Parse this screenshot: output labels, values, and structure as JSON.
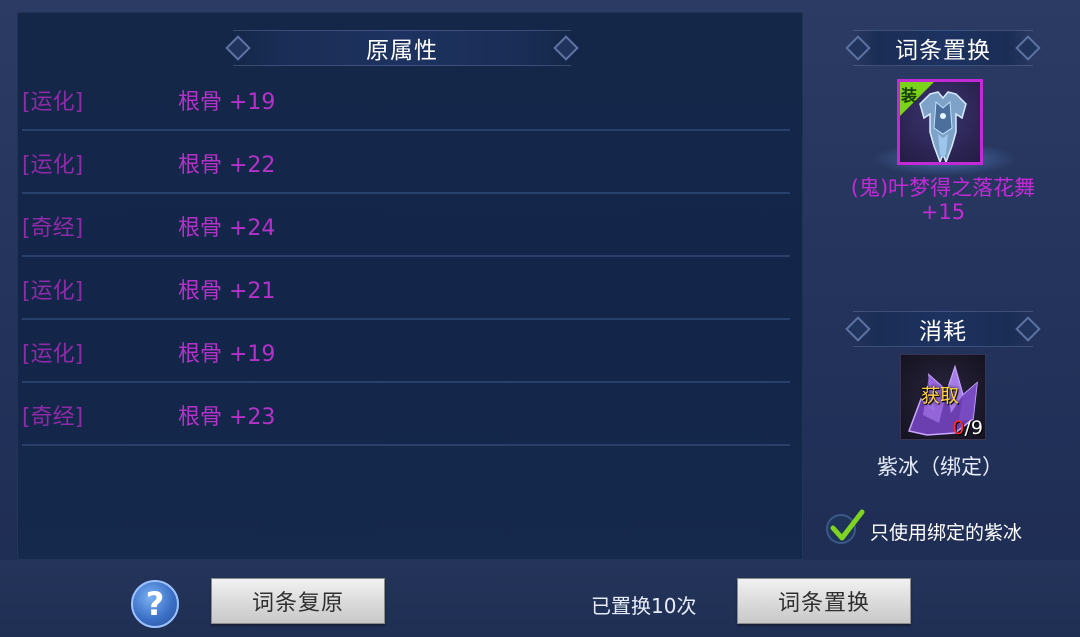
{
  "attributes": {
    "title": "原属性",
    "rows": [
      {
        "tag": "[运化]",
        "value": "根骨 +19"
      },
      {
        "tag": "[运化]",
        "value": "根骨 +22"
      },
      {
        "tag": "[奇经]",
        "value": "根骨 +24"
      },
      {
        "tag": "[运化]",
        "value": "根骨 +21"
      },
      {
        "tag": "[运化]",
        "value": "根骨 +19"
      },
      {
        "tag": "[奇经]",
        "value": "根骨 +23"
      }
    ]
  },
  "replace_panel": {
    "title": "词条置换",
    "item": {
      "badge": "装",
      "name_line1": "(鬼)叶梦得之落花舞",
      "name_line2": "+15",
      "icon": "armor-icon",
      "frame_color": "#c22ad6"
    }
  },
  "consume_panel": {
    "title": "消耗",
    "material": {
      "icon": "purple-crystal-icon",
      "obtain_label": "获取",
      "have": "0",
      "need": "/9",
      "name": "紫冰（绑定）"
    },
    "only_bound": {
      "checked": true,
      "label": "只使用绑定的紫冰"
    }
  },
  "bottom_bar": {
    "help_label": "?",
    "restore_label": "词条复原",
    "replace_count": "已置换10次",
    "replace_label": "词条置换"
  },
  "colors": {
    "attr_tag": "#8e2aa7",
    "attr_value": "#b532c9",
    "obtain_text": "#ffd43a",
    "count_have": "#ff2a2a"
  }
}
